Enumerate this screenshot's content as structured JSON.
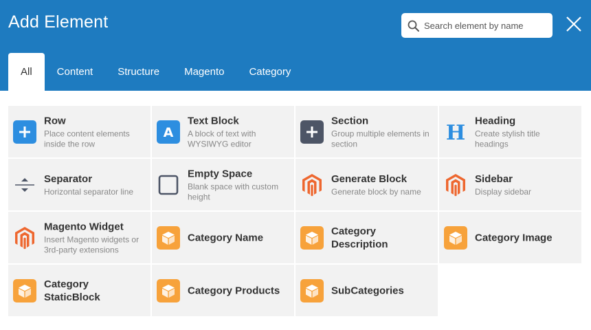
{
  "header": {
    "title": "Add Element",
    "search_placeholder": "Search element by name"
  },
  "tabs": [
    "All",
    "Content",
    "Structure",
    "Magento",
    "Category"
  ],
  "active_tab": "All",
  "colors": {
    "header_bg": "#1e7bc0",
    "blue_badge": "#2d8ee0",
    "dark_badge": "#4d5566",
    "orange_badge": "#f7a23b",
    "magento_orange": "#ee672f"
  },
  "elements": [
    {
      "name": "Row",
      "desc": "Place content elements inside the row",
      "icon": "plus-icon"
    },
    {
      "name": "Text Block",
      "desc": "A block of text with WYSIWYG editor",
      "icon": "text-a-icon"
    },
    {
      "name": "Section",
      "desc": "Group multiple elements in section",
      "icon": "plus-icon"
    },
    {
      "name": "Heading",
      "desc": "Create stylish title headings",
      "icon": "heading-h-icon"
    },
    {
      "name": "Separator",
      "desc": "Horizontal separator line",
      "icon": "separator-icon"
    },
    {
      "name": "Empty Space",
      "desc": "Blank space with custom height",
      "icon": "empty-square-icon"
    },
    {
      "name": "Generate Block",
      "desc": "Generate block by name",
      "icon": "magento-logo-icon"
    },
    {
      "name": "Sidebar",
      "desc": "Display sidebar",
      "icon": "magento-logo-icon"
    },
    {
      "name": "Magento Widget",
      "desc": "Insert Magento widgets or 3rd-party extensions",
      "icon": "magento-logo-icon"
    },
    {
      "name": "Category Name",
      "desc": "",
      "icon": "box-icon"
    },
    {
      "name": "Category Description",
      "desc": "",
      "icon": "box-icon"
    },
    {
      "name": "Category Image",
      "desc": "",
      "icon": "box-icon"
    },
    {
      "name": "Category StaticBlock",
      "desc": "",
      "icon": "box-icon"
    },
    {
      "name": "Category Products",
      "desc": "",
      "icon": "box-icon"
    },
    {
      "name": "SubCategories",
      "desc": "",
      "icon": "box-icon"
    }
  ]
}
